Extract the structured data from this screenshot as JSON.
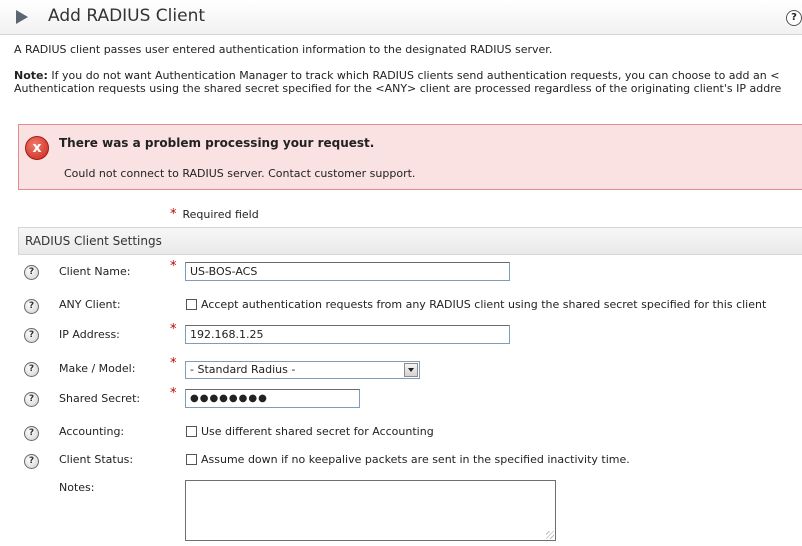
{
  "header": {
    "title": "Add RADIUS Client",
    "help": "?"
  },
  "intro": "A RADIUS client passes user entered authentication information to the designated RADIUS server.",
  "note": {
    "label": "Note:",
    "line1": " If you do not want Authentication Manager to track which RADIUS clients send authentication requests, you can choose to add an <",
    "line2": "Authentication requests using the shared secret specified for the <ANY> client are processed regardless of the originating client's IP addre"
  },
  "error": {
    "icon": "x",
    "title": "There was a problem processing your request.",
    "message": "Could not connect to RADIUS server. Contact customer support."
  },
  "required": {
    "star": "*",
    "text": "Required field"
  },
  "section": {
    "title": "RADIUS Client Settings"
  },
  "help_icon": "?",
  "fields": {
    "client_name": {
      "label": "Client Name:",
      "value": "US-BOS-ACS"
    },
    "any_client": {
      "label": "ANY Client:",
      "checkbox_label": "Accept authentication requests from any RADIUS client using the shared secret specified for this client"
    },
    "ip_address": {
      "label": "IP Address:",
      "value": "192.168.1.25"
    },
    "make_model": {
      "label": "Make / Model:",
      "selected": "- Standard Radius -"
    },
    "shared_secret": {
      "label": "Shared Secret:",
      "masked": "●●●●●●●●"
    },
    "accounting": {
      "label": "Accounting:",
      "checkbox_label": "Use different shared secret for Accounting"
    },
    "client_status": {
      "label": "Client Status:",
      "checkbox_label": "Assume down if no keepalive packets are sent in the specified inactivity time."
    },
    "notes": {
      "label": "Notes:",
      "value": ""
    }
  }
}
